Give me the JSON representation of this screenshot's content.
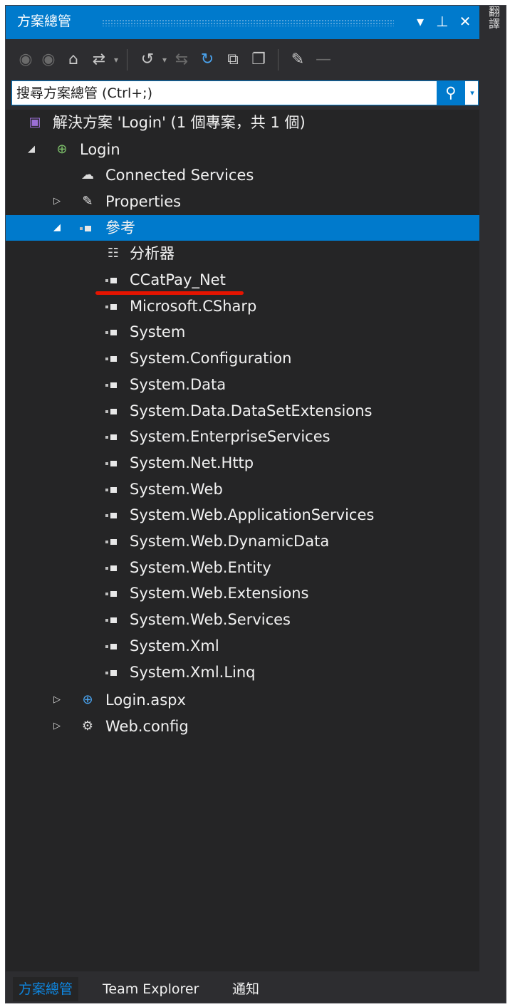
{
  "window": {
    "title": "方案總管",
    "accent": "#007acc",
    "controls": {
      "dropdown": "▾",
      "pin": "⊥",
      "close": "✕"
    }
  },
  "toolbar": {
    "icons": [
      "back-icon",
      "forward-icon",
      "home-icon",
      "sync-with-active-document-icon",
      "history-icon",
      "pending-changes-filter-icon",
      "refresh-icon",
      "collapse-all-icon",
      "show-all-files-icon",
      "properties-icon",
      "preview-icon"
    ]
  },
  "search": {
    "placeholder": "搜尋方案總管 (Ctrl+;)"
  },
  "tree": {
    "solution": "解決方案 'Login' (1 個專案，共 1 個)",
    "project": "Login",
    "connected_services": "Connected Services",
    "properties": "Properties",
    "references": "參考",
    "analyzers": "分析器",
    "reference_items": [
      "CCatPay_Net",
      "Microsoft.CSharp",
      "System",
      "System.Configuration",
      "System.Data",
      "System.Data.DataSetExtensions",
      "System.EnterpriseServices",
      "System.Net.Http",
      "System.Web",
      "System.Web.ApplicationServices",
      "System.Web.DynamicData",
      "System.Web.Entity",
      "System.Web.Extensions",
      "System.Web.Services",
      "System.Xml",
      "System.Xml.Linq"
    ],
    "files": [
      "Login.aspx",
      "Web.config"
    ],
    "highlight_color": "#e51400"
  },
  "side_tab": "翻譯",
  "bottom_tabs": [
    "方案總管",
    "Team Explorer",
    "通知"
  ]
}
